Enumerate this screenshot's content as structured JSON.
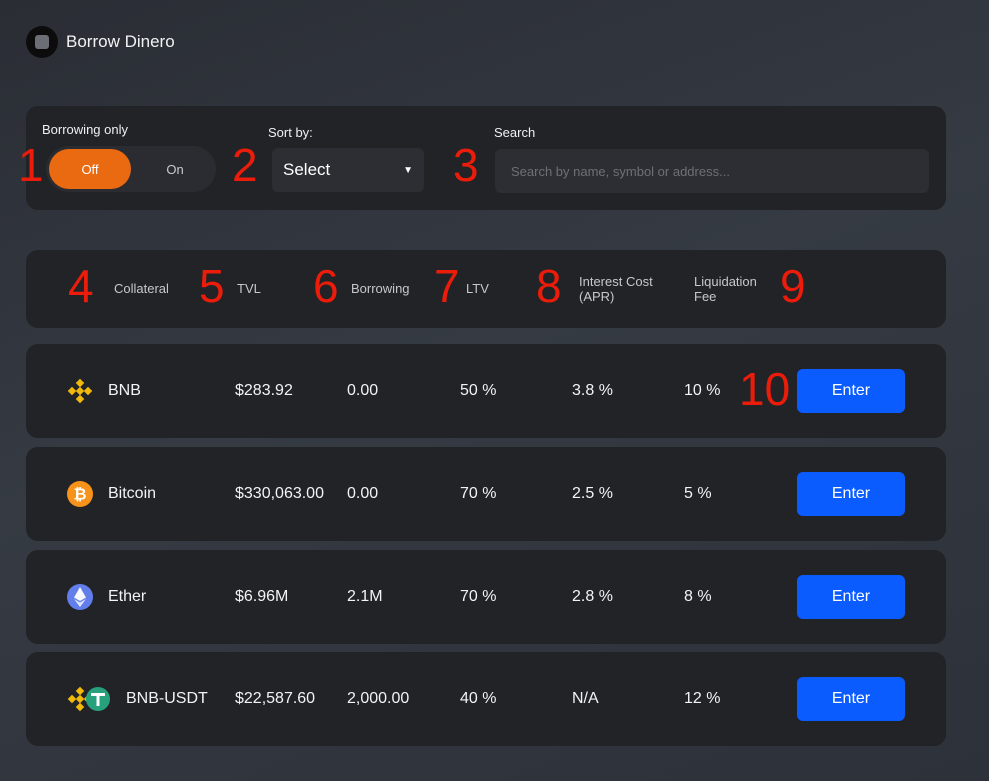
{
  "app": {
    "title": "Borrow Dinero"
  },
  "filters": {
    "borrowing_only_label": "Borrowing only",
    "toggle_off": "Off",
    "toggle_on": "On",
    "toggle_state": "Off",
    "sort_label": "Sort by:",
    "sort_value": "Select",
    "search_label": "Search",
    "search_placeholder": "Search by name, symbol or address..."
  },
  "columns": {
    "collateral": "Collateral",
    "tvl": "TVL",
    "borrowing": "Borrowing",
    "ltv": "LTV",
    "interest_line1": "Interest Cost",
    "interest_line2": "(APR)",
    "liquidation_line1": "Liquidation",
    "liquidation_line2": "Fee"
  },
  "rows": [
    {
      "name": "BNB",
      "icon": "bnb-icon",
      "tvl": "$283.92",
      "borrowing": "0.00",
      "ltv": "50 %",
      "interest": "3.8 %",
      "fee": "10 %",
      "action": "Enter"
    },
    {
      "name": "Bitcoin",
      "icon": "bitcoin-icon",
      "tvl": "$330,063.00",
      "borrowing": "0.00",
      "ltv": "70 %",
      "interest": "2.5 %",
      "fee": "5 %",
      "action": "Enter"
    },
    {
      "name": "Ether",
      "icon": "ether-icon",
      "tvl": "$6.96M",
      "borrowing": "2.1M",
      "ltv": "70 %",
      "interest": "2.8 %",
      "fee": "8 %",
      "action": "Enter"
    },
    {
      "name": "BNB-USDT",
      "icon": "bnb-usdt-icon",
      "tvl": "$22,587.60",
      "borrowing": "2,000.00",
      "ltv": "40 %",
      "interest": "N/A",
      "fee": "12 %",
      "action": "Enter"
    }
  ],
  "markers": [
    "1",
    "2",
    "3",
    "4",
    "5",
    "6",
    "7",
    "8",
    "9",
    "10"
  ],
  "colors": {
    "accent_orange": "#ea6a12",
    "button_blue": "#0a5cff",
    "marker_red": "#ec1c0b",
    "card": "#222327"
  }
}
